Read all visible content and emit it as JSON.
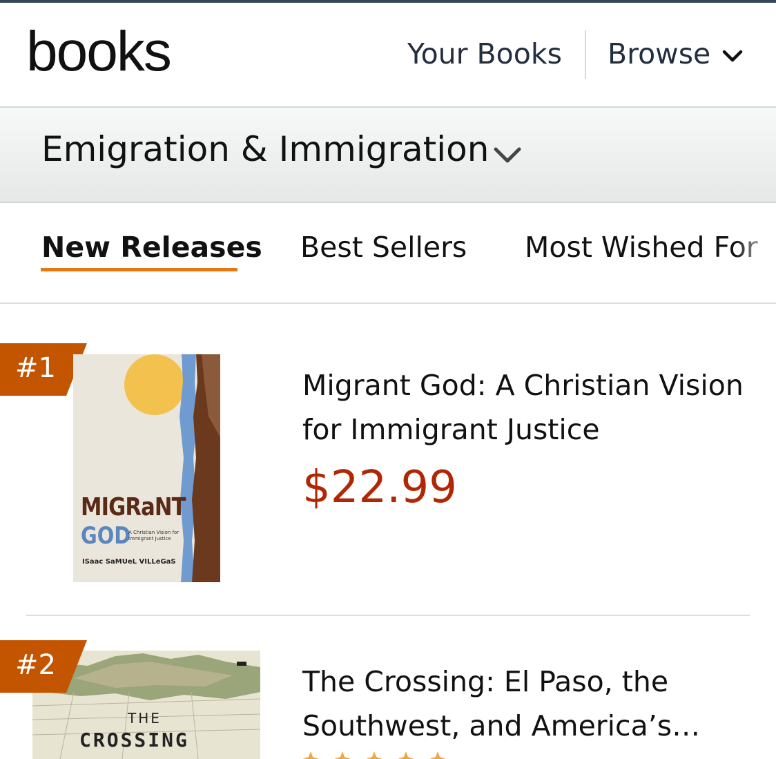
{
  "header": {
    "logo": "books",
    "your_books": "Your Books",
    "browse": "Browse"
  },
  "category": {
    "title": "Emigration & Immigration"
  },
  "tabs": [
    {
      "label": "New Releases",
      "active": true
    },
    {
      "label": "Best Sellers",
      "active": false
    },
    {
      "label": "Most Wished For",
      "active": false
    }
  ],
  "colors": {
    "accent_orange": "#e47911",
    "rank_badge": "#c45500",
    "price_red": "#b12704",
    "nav_text": "#232f3e"
  },
  "items": [
    {
      "rank": "#1",
      "title": "Migrant God: A Christian Vision for Immigrant Justice",
      "price": "$22.99",
      "cover": {
        "title_line1": "MIGRaNT",
        "title_line2": "GOD",
        "subtitle_line1": "A Christian Vision for",
        "subtitle_line2": "Immigrant Justice",
        "author": "ISaac SaMUeL VILLeGaS"
      }
    },
    {
      "rank": "#2",
      "title": "The Crossing: El Paso, the Southwest, and America’s…",
      "cover": {
        "title_line1": "THE",
        "title_line2": "CROSSING"
      }
    }
  ]
}
